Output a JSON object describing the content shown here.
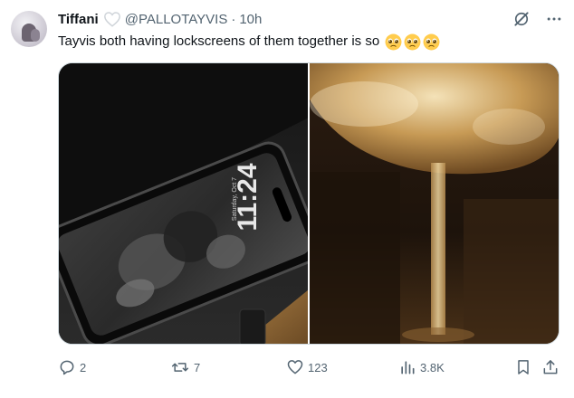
{
  "author": {
    "name": "Tiffani",
    "handle": "@PALLOTAYVIS",
    "separator": "·",
    "time": "10h"
  },
  "tweet": {
    "text": "Tayvis both having lockscreens of them together is so",
    "emoji_count": 3,
    "emoji_name": "pleading-face-emoji"
  },
  "media": {
    "left_image": {
      "description_icon": "phone-lockscreen-photo",
      "clock_text": "11:24",
      "date_text": "Saturday, Oct 7"
    },
    "right_image": {
      "description_icon": "glass-photo"
    }
  },
  "actions": {
    "replies": "2",
    "reposts": "7",
    "likes": "123",
    "views": "3.8K"
  },
  "colors": {
    "text_primary": "#0f1419",
    "text_secondary": "#536471",
    "border": "#cfd9de"
  }
}
